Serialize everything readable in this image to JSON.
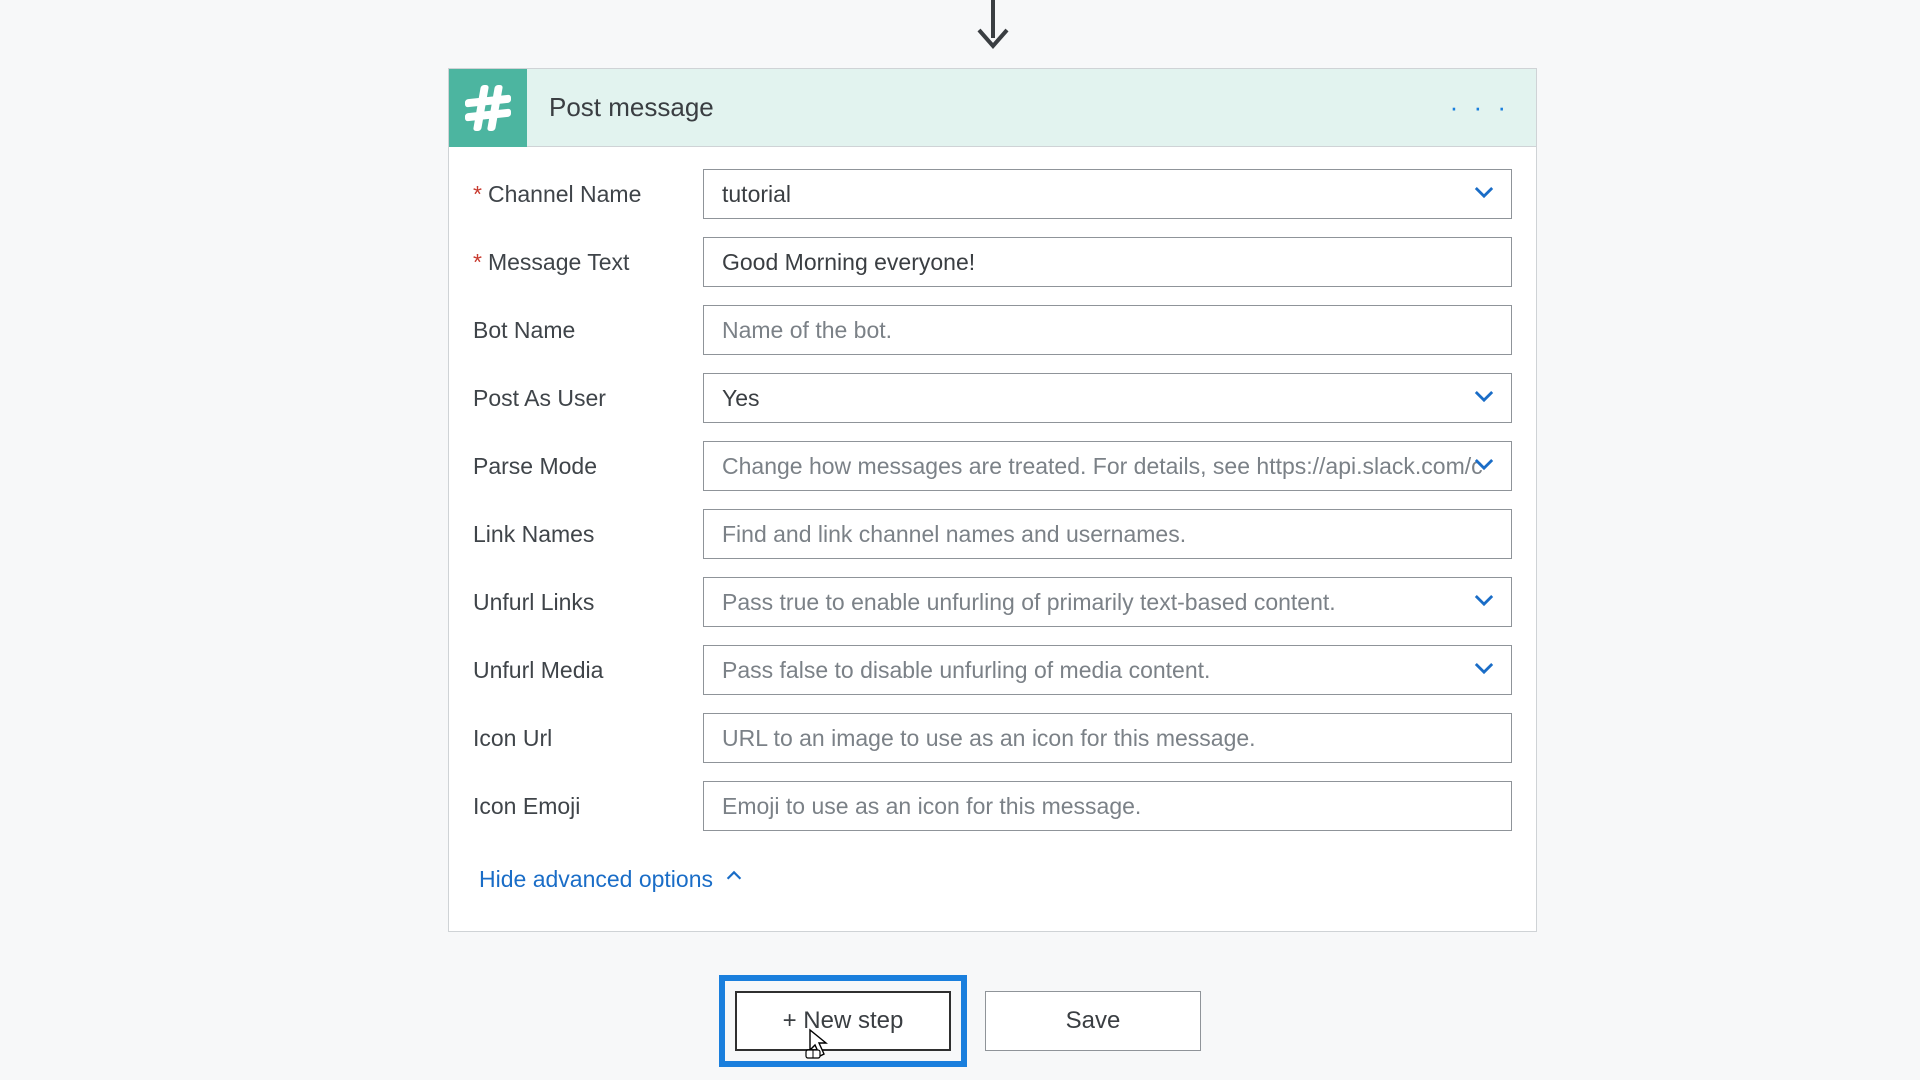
{
  "card": {
    "title": "Post message",
    "icon_name": "slack-hash-icon"
  },
  "fields": {
    "channel_name": {
      "label": "Channel Name",
      "value": "tutorial",
      "required": true
    },
    "message_text": {
      "label": "Message Text",
      "value": "Good Morning everyone!",
      "required": true
    },
    "bot_name": {
      "label": "Bot Name",
      "placeholder": "Name of the bot."
    },
    "post_as_user": {
      "label": "Post As User",
      "value": "Yes"
    },
    "parse_mode": {
      "label": "Parse Mode",
      "placeholder": "Change how messages are treated. For details, see https://api.slack.com/c"
    },
    "link_names": {
      "label": "Link Names",
      "placeholder": "Find and link channel names and usernames."
    },
    "unfurl_links": {
      "label": "Unfurl Links",
      "placeholder": "Pass true to enable unfurling of primarily text-based content."
    },
    "unfurl_media": {
      "label": "Unfurl Media",
      "placeholder": "Pass false to disable unfurling of media content."
    },
    "icon_url": {
      "label": "Icon Url",
      "placeholder": "URL to an image to use as an icon for this message."
    },
    "icon_emoji": {
      "label": "Icon Emoji",
      "placeholder": "Emoji to use as an icon for this message."
    }
  },
  "advanced_toggle_label": "Hide advanced options",
  "footer": {
    "new_step_label": "+ New step",
    "save_label": "Save"
  }
}
